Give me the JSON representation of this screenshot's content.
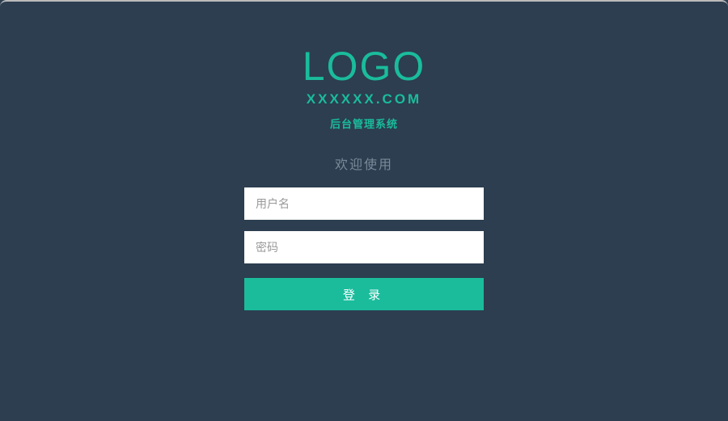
{
  "header": {
    "logo": "LOGO",
    "domain": "XXXXXX.COM",
    "subtitle": "后台管理系统"
  },
  "welcome": "欢迎使用",
  "form": {
    "username_placeholder": "用户名",
    "password_placeholder": "密码",
    "login_label": "登 录"
  },
  "colors": {
    "background": "#2c3e50",
    "accent": "#1abc9c",
    "input_bg": "#ffffff",
    "muted_text": "#7a8a99"
  }
}
